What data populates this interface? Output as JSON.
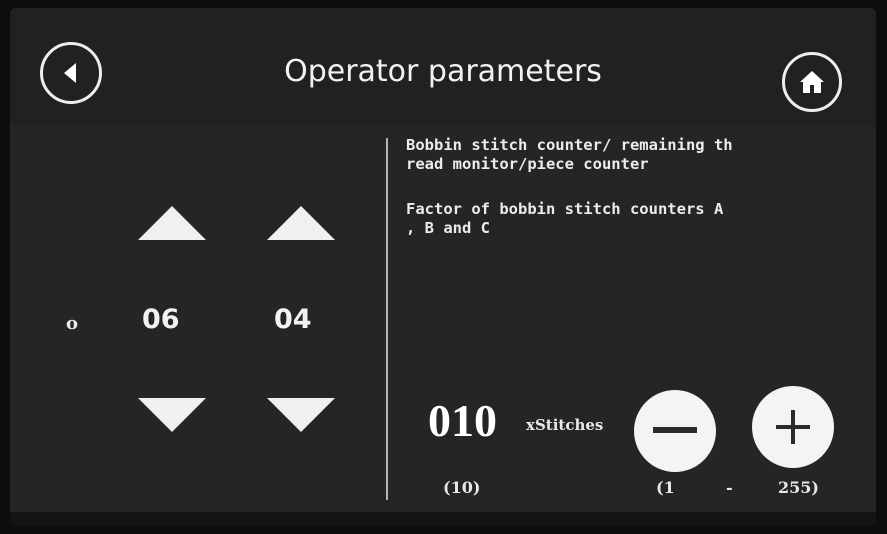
{
  "header": {
    "title": "Operator parameters"
  },
  "icons": {
    "back": "back-arrow-icon",
    "home": "home-icon",
    "up": "triangle-up-icon",
    "down": "triangle-down-icon",
    "minus": "minus-icon",
    "plus": "plus-icon"
  },
  "left_panel": {
    "prefix": "o",
    "digit_1": "06",
    "digit_2": "04"
  },
  "right_panel": {
    "description_1": "Bobbin stitch counter/ remaining th\nread monitor/piece counter",
    "description_2": "Factor of bobbin stitch counters A\n, B and C",
    "value": "010",
    "unit": "xStitches",
    "default": "(10)",
    "range_min": "(1",
    "range_sep": "-",
    "range_max": "255)"
  },
  "colors": {
    "background": "#262524",
    "header": "#222120",
    "foreground": "#ffffff"
  }
}
